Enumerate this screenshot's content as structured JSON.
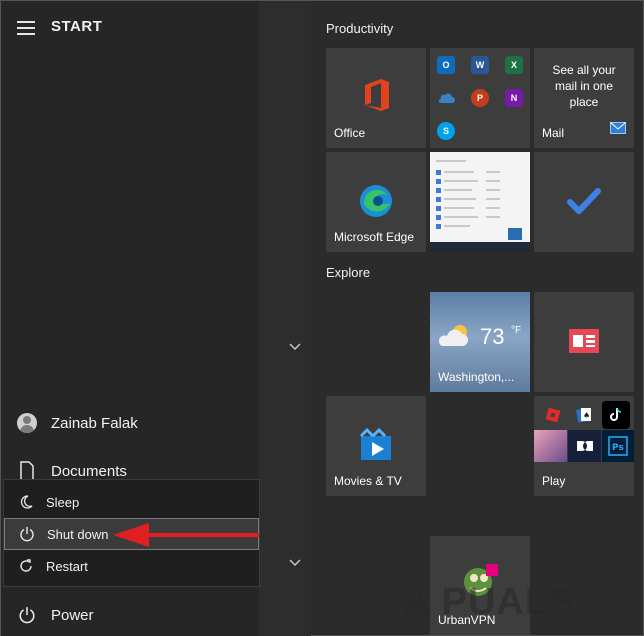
{
  "start": {
    "title": "START"
  },
  "user": {
    "name": "Zainab Falak"
  },
  "rail": {
    "documents_label": "Documents",
    "power_label": "Power"
  },
  "power_menu": {
    "items": [
      {
        "label": "Sleep",
        "icon": "moon-icon"
      },
      {
        "label": "Shut down",
        "icon": "power-icon"
      },
      {
        "label": "Restart",
        "icon": "restart-icon"
      }
    ],
    "highlighted": "Shut down"
  },
  "groups": {
    "productivity": "Productivity",
    "explore": "Explore"
  },
  "tiles": {
    "office": "Office",
    "mail_text": "See all your mail in one place",
    "mail": "Mail",
    "edge": "Microsoft Edge",
    "weather_temp": "73",
    "weather_unit": "°F",
    "weather_city": "Washington,...",
    "movies": "Movies & TV",
    "play": "Play",
    "urbanvpn": "UrbanVPN"
  },
  "office_apps": [
    {
      "icon": "outlook-icon",
      "letter": "O",
      "color": "#0f6cbd"
    },
    {
      "icon": "word-icon",
      "letter": "W",
      "color": "#2b5797"
    },
    {
      "icon": "excel-icon",
      "letter": "X",
      "color": "#1e7145"
    },
    {
      "icon": "onedrive-icon",
      "letter": "",
      "color": "#3b82c4"
    },
    {
      "icon": "powerpoint-icon",
      "letter": "P",
      "color": "#c43e1c"
    },
    {
      "icon": "onenote-icon",
      "letter": "N",
      "color": "#7719aa"
    },
    {
      "icon": "skype-icon",
      "letter": "S",
      "color": "#00a2ed"
    }
  ],
  "watermark": "A PUALS",
  "colors": {
    "accent_red": "#e02020",
    "tile_bg": "#3d3d3d"
  }
}
